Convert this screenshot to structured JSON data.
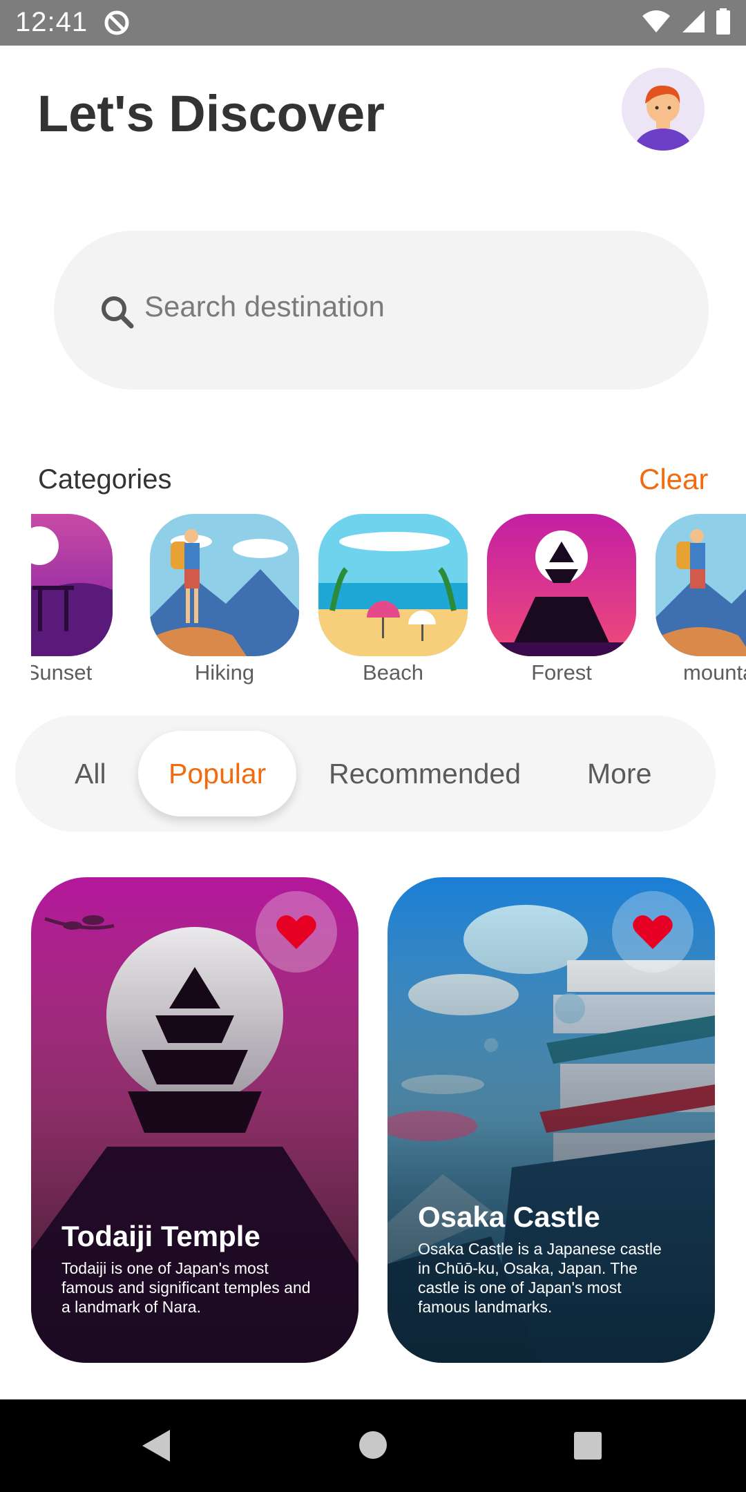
{
  "status_bar": {
    "time": "12:41"
  },
  "header": {
    "title": "Let's Discover"
  },
  "search": {
    "placeholder": "Search destination"
  },
  "categories": {
    "title": "Categories",
    "clear_label": "Clear",
    "items": [
      {
        "label": "Sunset"
      },
      {
        "label": "Hiking"
      },
      {
        "label": "Beach"
      },
      {
        "label": "Forest"
      },
      {
        "label": "mountain"
      }
    ]
  },
  "tabs": [
    {
      "label": "All"
    },
    {
      "label": "Popular"
    },
    {
      "label": "Recommended"
    },
    {
      "label": "More"
    }
  ],
  "cards": [
    {
      "title": "Todaiji Temple",
      "line1": "Todaiji is one of Japan's most",
      "line2": "famous and significant temples and",
      "line3": "a landmark of Nara."
    },
    {
      "title": "Osaka Castle",
      "line1": "Osaka Castle is a Japanese castle",
      "line2": "in Chūō-ku, Osaka, Japan. The",
      "line3": "castle is one of Japan's most",
      "line4": "famous landmarks."
    }
  ],
  "colors": {
    "accent": "#f26b0f",
    "heart": "#e60023",
    "status_bar": "#7d7d7d"
  }
}
